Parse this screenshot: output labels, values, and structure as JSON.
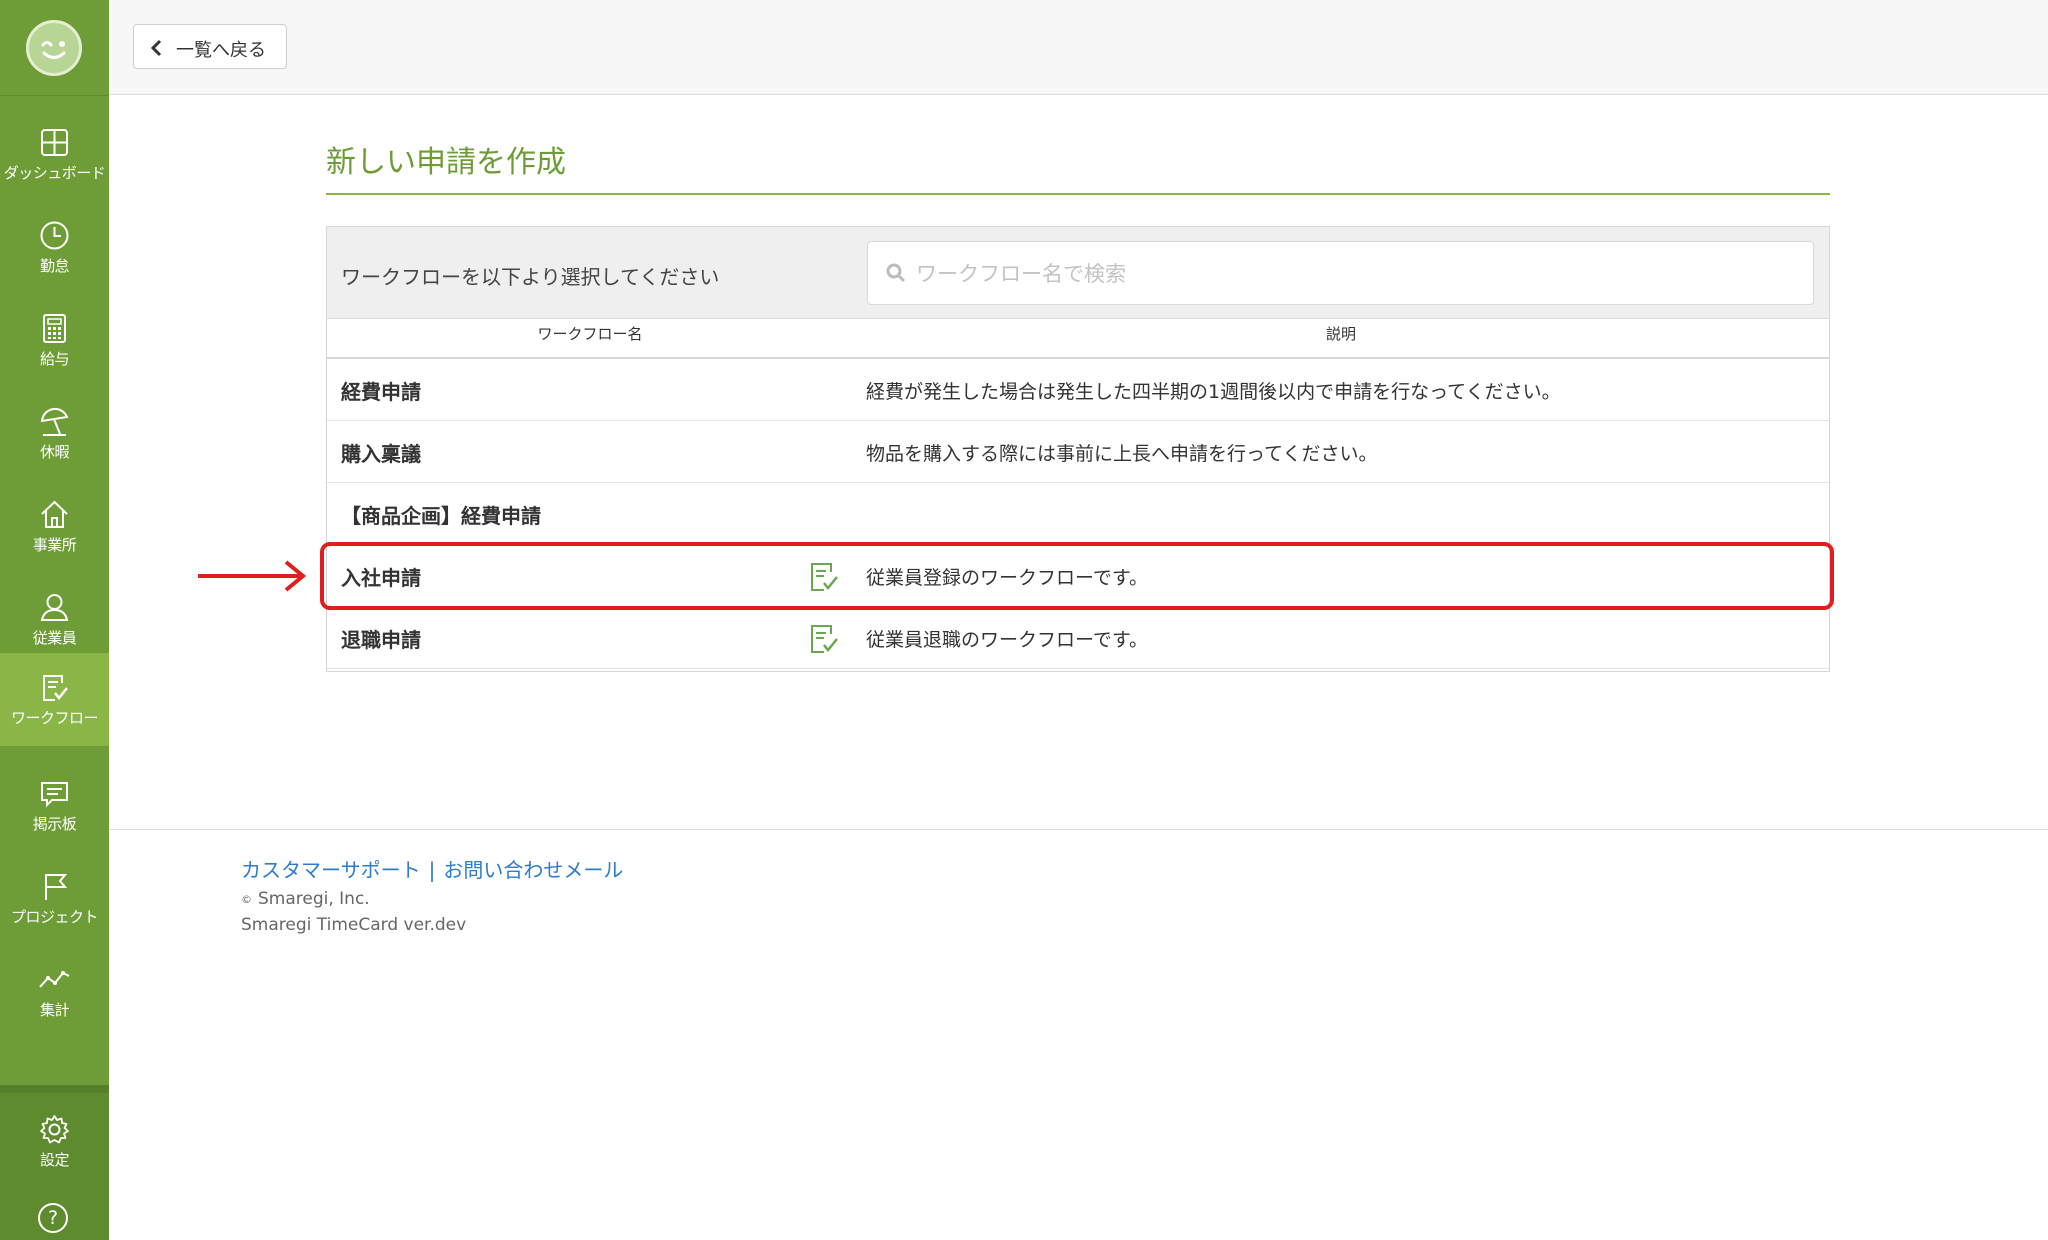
{
  "colors": {
    "sidebar": "#6e9d37",
    "sidebar_active": "#8ab648",
    "title_green": "#6e9d37",
    "link_blue": "#2f7ccd",
    "highlight_red": "#e01e1e"
  },
  "sidebar": {
    "items": [
      {
        "label": "ダッシュボード",
        "icon": "dashboard-icon"
      },
      {
        "label": "勤怠",
        "icon": "clock-icon"
      },
      {
        "label": "給与",
        "icon": "calculator-icon"
      },
      {
        "label": "休暇",
        "icon": "beach-umbrella-icon"
      },
      {
        "label": "事業所",
        "icon": "home-icon"
      },
      {
        "label": "従業員",
        "icon": "user-icon"
      },
      {
        "label": "ワークフロー",
        "icon": "workflow-icon",
        "active": true
      },
      {
        "label": "掲示板",
        "icon": "chat-icon"
      },
      {
        "label": "プロジェクト",
        "icon": "flag-icon"
      },
      {
        "label": "集計",
        "icon": "line-chart-icon"
      }
    ],
    "settings_label": "設定",
    "help_label": "?"
  },
  "topbar": {
    "back_label": "一覧へ戻る"
  },
  "main": {
    "title": "新しい申請を作成",
    "prompt": "ワークフローを以下より選択してください",
    "search_placeholder": "ワークフロー名で検索",
    "columns": {
      "name": "ワークフロー名",
      "description": "説明"
    },
    "rows": [
      {
        "name": "経費申請",
        "description": "経費が発生した場合は発生した四半期の1週間後以内で申請を行なってください。",
        "has_icon": false
      },
      {
        "name": "購入稟議",
        "description": "物品を購入する際には事前に上長へ申請を行ってください。",
        "has_icon": false
      },
      {
        "name": "【商品企画】経費申請",
        "description": "",
        "has_icon": false
      },
      {
        "name": "入社申請",
        "description": "従業員登録のワークフローです。",
        "has_icon": true,
        "highlighted": true
      },
      {
        "name": "退職申請",
        "description": "従業員退職のワークフローです。",
        "has_icon": true
      }
    ]
  },
  "footer": {
    "support_link": "カスタマーサポート",
    "divider": "|",
    "contact_link": "お問い合わせメール",
    "copyright_symbol": "©",
    "copyright": "Smaregi, Inc.",
    "version": "Smaregi TimeCard ver.dev"
  }
}
